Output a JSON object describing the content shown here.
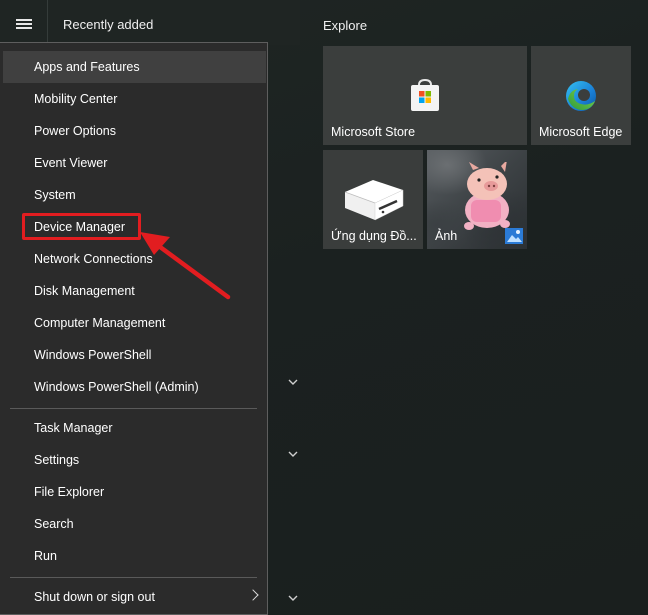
{
  "header": {
    "recently_added": "Recently added"
  },
  "menu": {
    "items": [
      {
        "label": "Apps and Features"
      },
      {
        "label": "Mobility Center"
      },
      {
        "label": "Power Options"
      },
      {
        "label": "Event Viewer"
      },
      {
        "label": "System"
      },
      {
        "label": "Device Manager"
      },
      {
        "label": "Network Connections"
      },
      {
        "label": "Disk Management"
      },
      {
        "label": "Computer Management"
      },
      {
        "label": "Windows PowerShell"
      },
      {
        "label": "Windows PowerShell (Admin)"
      },
      {
        "label": "Task Manager"
      },
      {
        "label": "Settings"
      },
      {
        "label": "File Explorer"
      },
      {
        "label": "Search"
      },
      {
        "label": "Run"
      },
      {
        "label": "Shut down or sign out"
      }
    ]
  },
  "explore": {
    "title": "Explore",
    "tiles": [
      {
        "label": "Microsoft Store",
        "icon": "store-icon"
      },
      {
        "label": "Microsoft Edge",
        "icon": "edge-icon"
      },
      {
        "label": "Ứng dụng Đồ...",
        "icon": "server-icon"
      },
      {
        "label": "Ảnh",
        "icon": "photos-icon"
      }
    ]
  },
  "colors": {
    "highlight": "#e21d20",
    "menu_bg": "#2b2b2b",
    "hover_bg": "#404040"
  }
}
